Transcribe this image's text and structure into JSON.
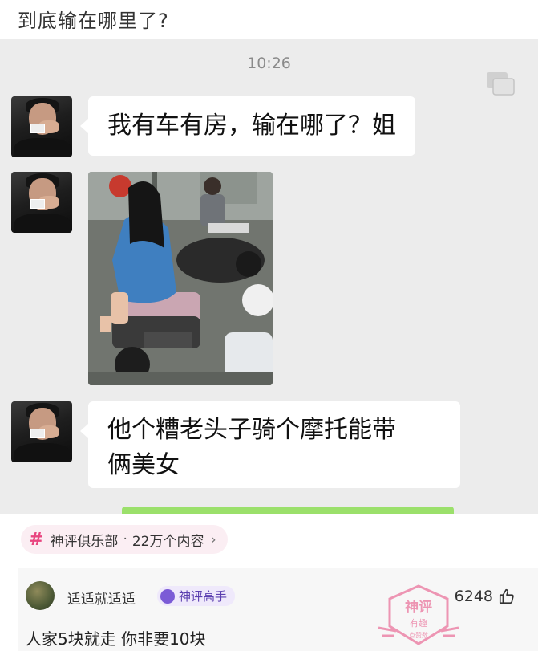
{
  "post": {
    "title": "到底输在哪里了?"
  },
  "chat": {
    "time": "10:26",
    "messages": [
      {
        "text": "我有车有房，输在哪了？姐"
      },
      {
        "text_line1": "他个糟老头子骑个摩托能带",
        "text_line2": "俩美女"
      }
    ]
  },
  "topic": {
    "hash": "#",
    "name": "神评俱乐部",
    "separator": "·",
    "count": "22万个内容",
    "chevron": "›"
  },
  "comment": {
    "username": "适适就适适",
    "badge": "神评高手",
    "text": "人家5块就走 你非要10块",
    "likes": "6248",
    "stamp_line1": "神评",
    "stamp_line2": "有趣",
    "stamp_line3": "点赞数"
  },
  "icons": {
    "multiwindow": "multi-window-icon",
    "like": "thumbs-up-icon"
  },
  "colors": {
    "accent": "#e8457f",
    "badge": "#7b5bd6",
    "chat_bg": "#ececec",
    "stamp": "#e8628f"
  }
}
